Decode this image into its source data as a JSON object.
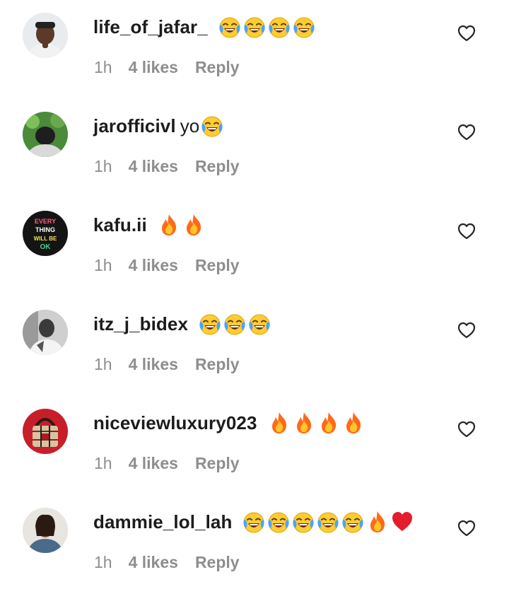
{
  "comments": [
    {
      "username": "life_of_jafar_",
      "text": "",
      "emojis": [
        "laughing-tears",
        "laughing-tears",
        "laughing-tears",
        "laughing-tears"
      ],
      "time": "1h",
      "likes": "4 likes",
      "reply": "Reply",
      "avatar": "avatar-man-hand-on-chin"
    },
    {
      "username": "jarofficivl",
      "text": "yo",
      "emojis": [
        "laughing-tears"
      ],
      "time": "1h",
      "likes": "4 likes",
      "reply": "Reply",
      "avatar": "avatar-person-head-down-green"
    },
    {
      "username": "kafu.ii",
      "text": "",
      "emojis": [
        "fire",
        "fire"
      ],
      "time": "1h",
      "likes": "4 likes",
      "reply": "Reply",
      "avatar": "avatar-text-every-thing-will-be-ok",
      "avatar_text": [
        "EVERY",
        "THING",
        "WILL BE",
        "OK"
      ]
    },
    {
      "username": "itz_j_bidex",
      "text": "",
      "emojis": [
        "laughing-tears",
        "laughing-tears",
        "laughing-tears"
      ],
      "time": "1h",
      "likes": "4 likes",
      "reply": "Reply",
      "avatar": "avatar-grayscale-man"
    },
    {
      "username": "niceviewluxury023",
      "text": "",
      "emojis": [
        "fire",
        "fire",
        "fire",
        "fire"
      ],
      "time": "1h",
      "likes": "4 likes",
      "reply": "Reply",
      "avatar": "avatar-red-handbag"
    },
    {
      "username": "dammie_lol_lah",
      "text": "",
      "emojis": [
        "laughing-tears",
        "laughing-tears",
        "laughing-tears",
        "laughing-tears",
        "laughing-tears",
        "fire",
        "red-heart"
      ],
      "time": "1h",
      "likes": "4 likes",
      "reply": "Reply",
      "avatar": "avatar-woman-portrait"
    }
  ],
  "colors": {
    "meta": "#8e8e8e",
    "username": "#1c1c1c",
    "heart_outline": "#262626"
  }
}
